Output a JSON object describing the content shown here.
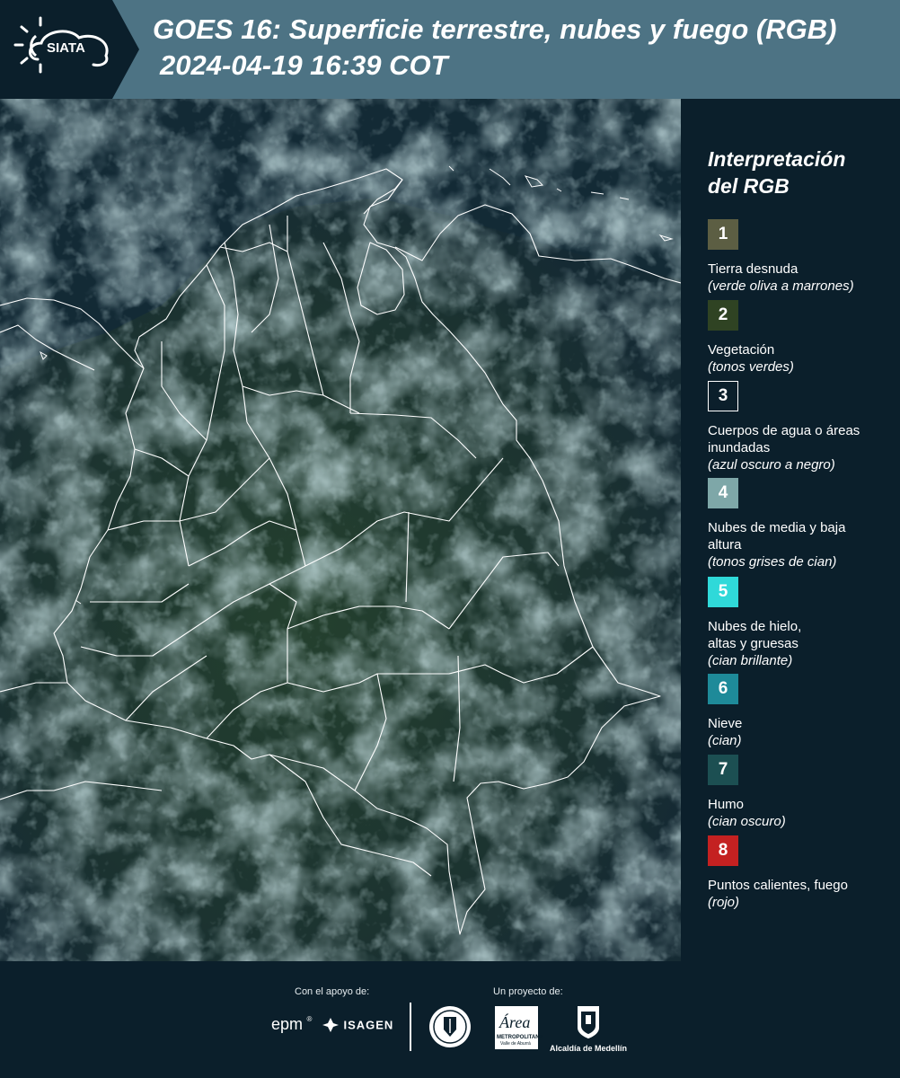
{
  "header": {
    "brand": "SIATA",
    "title": "GOES 16: Superficie terrestre, nubes y fuego (RGB)",
    "subtitle": "2024-04-19 16:39 COT"
  },
  "legend": {
    "title_line1": "Interpretación",
    "title_line2": "del RGB",
    "items": [
      {
        "number": "1",
        "label": "Tierra desnuda",
        "desc": "(verde oliva a marrones)",
        "color": "#5c5e43"
      },
      {
        "number": "2",
        "label": "Vegetación",
        "desc": "(tonos verdes)",
        "color": "#2f4323"
      },
      {
        "number": "3",
        "label": "Cuerpos de agua o áreas inundadas",
        "desc": "(azul oscuro a negro)",
        "color": "#0b1f2b"
      },
      {
        "number": "4",
        "label": "Nubes de media y baja altura",
        "desc": "(tonos grises de cian)",
        "color": "#7ea7a8"
      },
      {
        "number": "5",
        "label": "Nubes de hielo, altas y gruesas",
        "desc": "(cian brillante)",
        "color": "#2fd9d9"
      },
      {
        "number": "6",
        "label": "Nieve",
        "desc": "(cian)",
        "color": "#1e8a99"
      },
      {
        "number": "7",
        "label": "Humo",
        "desc": "(cian oscuro)",
        "color": "#1c4f52"
      },
      {
        "number": "8",
        "label": "Puntos calientes, fuego",
        "desc": "(rojo)",
        "color": "#c42121"
      }
    ]
  },
  "footer": {
    "support_label": "Con el apoyo de:",
    "project_label": "Un proyecto de:",
    "sponsors": {
      "epm": "epm",
      "isagen": "ISAGEN",
      "area_line1": "Área",
      "area_line2": "METROPOLITANA",
      "area_line3": "Valle de Aburrá",
      "alcaldia": "Alcaldía de Medellín"
    }
  },
  "colors": {
    "header_bg": "#4d7384",
    "page_bg": "#0b1f2b",
    "border_line": "#ffffff"
  }
}
